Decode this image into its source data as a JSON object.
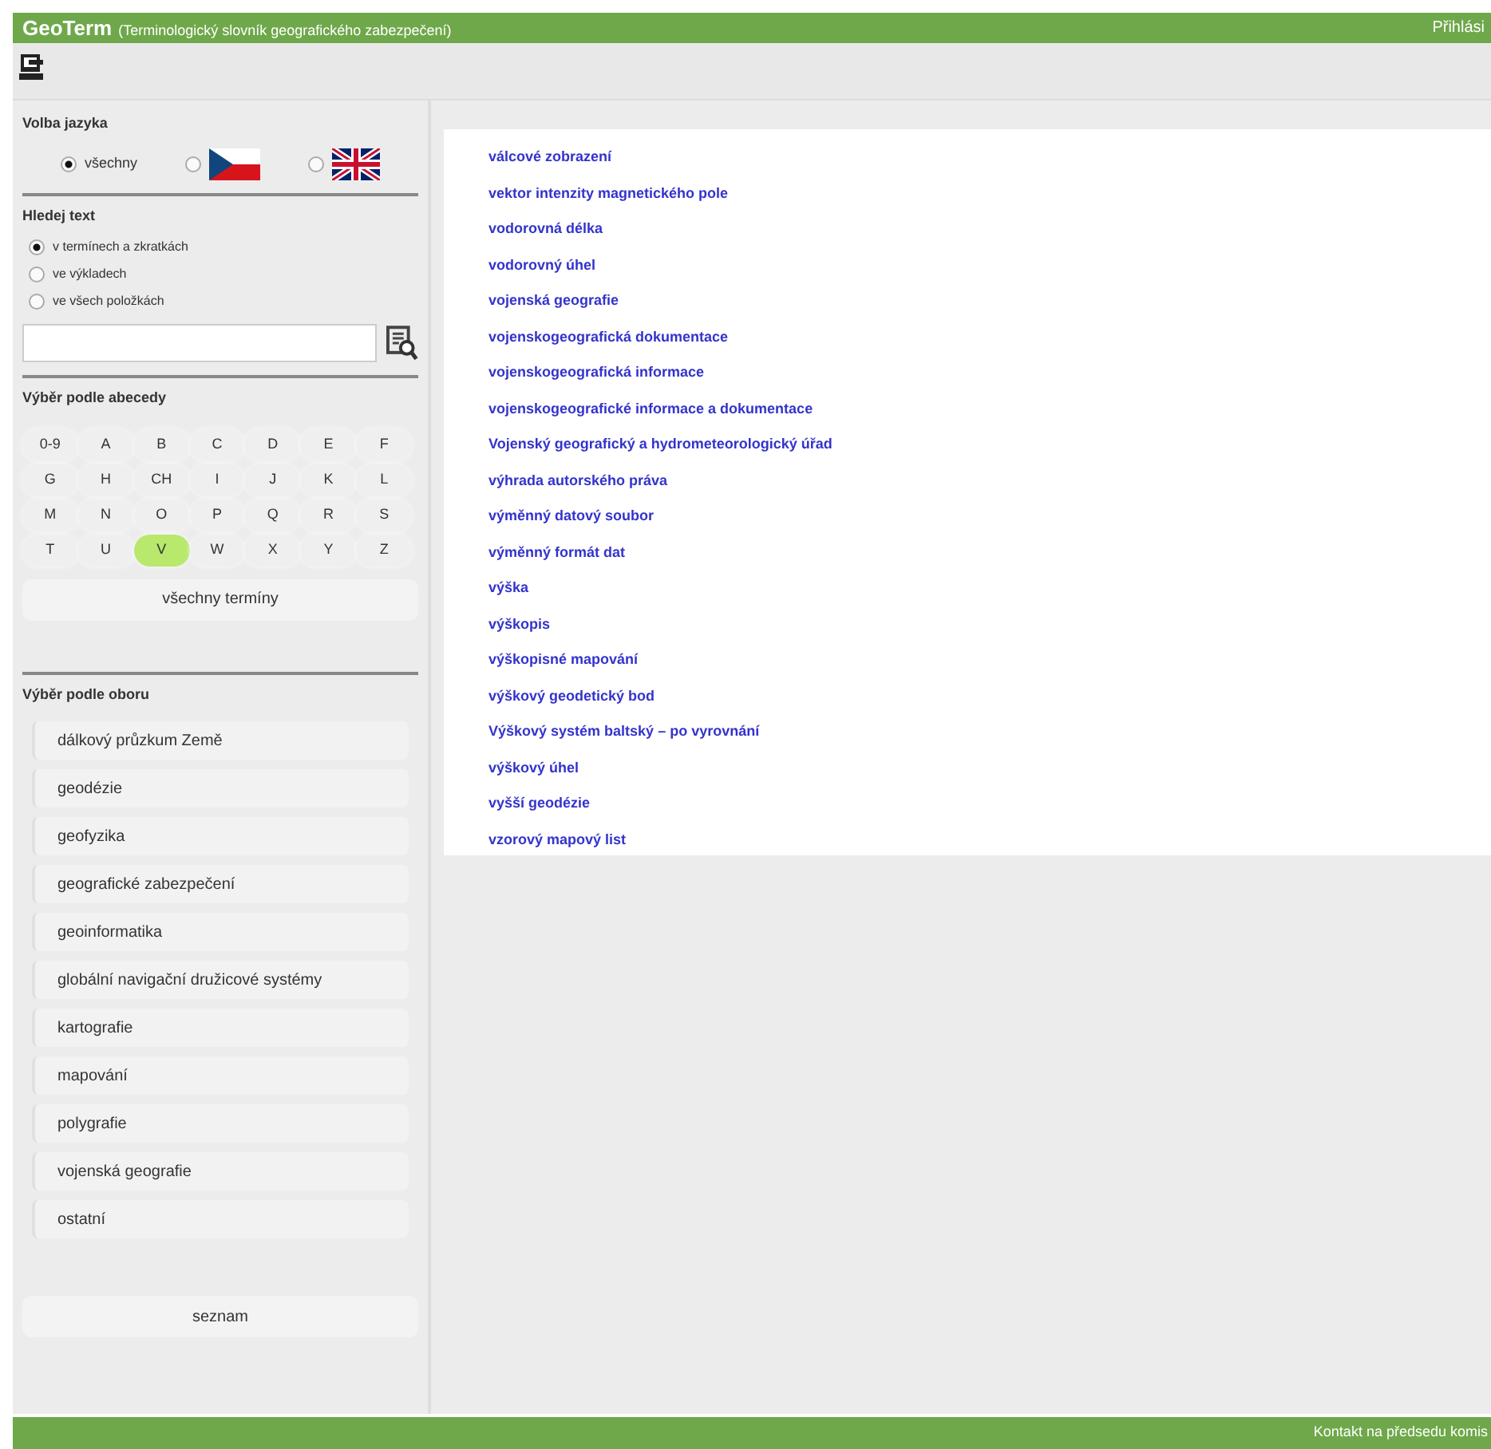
{
  "header": {
    "logo": "GeoTerm",
    "subtitle": "(Terminologický slovník geografického zabezpečení)",
    "login": "Přihlási"
  },
  "sidebar": {
    "language": {
      "title": "Volba jazyka",
      "options": [
        {
          "kind": "text",
          "label": "všechny",
          "selected": true
        },
        {
          "kind": "flag-cz",
          "selected": false
        },
        {
          "kind": "flag-gb",
          "selected": false
        }
      ]
    },
    "search": {
      "title": "Hledej text",
      "scopes": [
        {
          "label": "v termínech a zkratkách",
          "selected": true
        },
        {
          "label": "ve výkladech",
          "selected": false
        },
        {
          "label": "ve všech položkách",
          "selected": false
        }
      ]
    },
    "alphabet": {
      "title": "Výběr podle abecedy",
      "letters": [
        {
          "label": "0-9",
          "selected": false
        },
        {
          "label": "A",
          "selected": false
        },
        {
          "label": "B",
          "selected": false
        },
        {
          "label": "C",
          "selected": false
        },
        {
          "label": "D",
          "selected": false
        },
        {
          "label": "E",
          "selected": false
        },
        {
          "label": "F",
          "selected": false
        },
        {
          "label": "G",
          "selected": false
        },
        {
          "label": "H",
          "selected": false
        },
        {
          "label": "CH",
          "selected": false
        },
        {
          "label": "I",
          "selected": false
        },
        {
          "label": "J",
          "selected": false
        },
        {
          "label": "K",
          "selected": false
        },
        {
          "label": "L",
          "selected": false
        },
        {
          "label": "M",
          "selected": false
        },
        {
          "label": "N",
          "selected": false
        },
        {
          "label": "O",
          "selected": false
        },
        {
          "label": "P",
          "selected": false
        },
        {
          "label": "Q",
          "selected": false
        },
        {
          "label": "R",
          "selected": false
        },
        {
          "label": "S",
          "selected": false
        },
        {
          "label": "T",
          "selected": false
        },
        {
          "label": "U",
          "selected": false
        },
        {
          "label": "V",
          "selected": true
        },
        {
          "label": "W",
          "selected": false
        },
        {
          "label": "X",
          "selected": false
        },
        {
          "label": "Y",
          "selected": false
        },
        {
          "label": "Z",
          "selected": false
        }
      ],
      "all_button": "všechny termíny"
    },
    "domains": {
      "title": "Výběr podle oboru",
      "items": [
        "dálkový průzkum Země",
        "geodézie",
        "geofyzika",
        "geografické zabezpečení",
        "geoinformatika",
        "globální navigační družicové systémy",
        "kartografie",
        "mapování",
        "polygrafie",
        "vojenská geografie",
        "ostatní"
      ],
      "list_button": "seznam"
    }
  },
  "terms": [
    "válcové zobrazení",
    "vektor intenzity magnetického pole",
    "vodorovná délka",
    "vodorovný úhel",
    "vojenská geografie",
    "vojenskogeografická dokumentace",
    "vojenskogeografická informace",
    "vojenskogeografické informace a dokumentace",
    "Vojenský geografický a hydrometeorologický úřad",
    "výhrada autorského práva",
    "výměnný datový soubor",
    "výměnný formát dat",
    "výška",
    "výškopis",
    "výškopisné mapování",
    "výškový geodetický bod",
    "Výškový systém baltský – po vyrovnání",
    "výškový úhel",
    "vyšší geodézie",
    "vzorový mapový list"
  ],
  "footer": {
    "contact": "Kontakt na předsedu komis"
  }
}
